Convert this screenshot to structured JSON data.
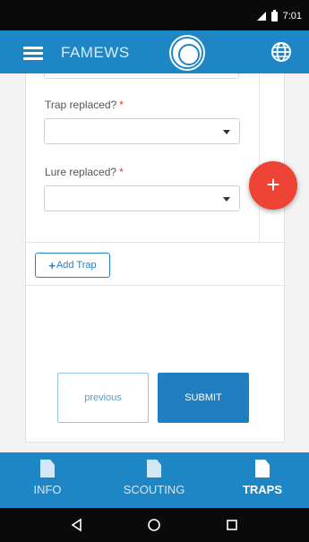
{
  "status": {
    "time": "7:01"
  },
  "app": {
    "title": "FAMEWS"
  },
  "form": {
    "trap_replaced_label": "Trap replaced?",
    "lure_replaced_label": "Lure replaced?",
    "required_mark": "*",
    "trap_replaced_value": "",
    "lure_replaced_value": "",
    "add_trap_label": "Add Trap",
    "add_trap_plus": "+",
    "fab_label": "+"
  },
  "buttons": {
    "previous": "previous",
    "submit": "SUBMIT"
  },
  "bottom_nav": [
    {
      "label": "INFO",
      "active": false
    },
    {
      "label": "SCOUTING",
      "active": false
    },
    {
      "label": "TRAPS",
      "active": true
    }
  ],
  "colors": {
    "primary": "#1f86c6",
    "fab": "#ee4436",
    "required": "#e53935"
  },
  "icons": [
    "menu-icon",
    "fao-logo",
    "globe-icon",
    "document-icon",
    "back-icon",
    "home-icon",
    "recents-icon"
  ]
}
